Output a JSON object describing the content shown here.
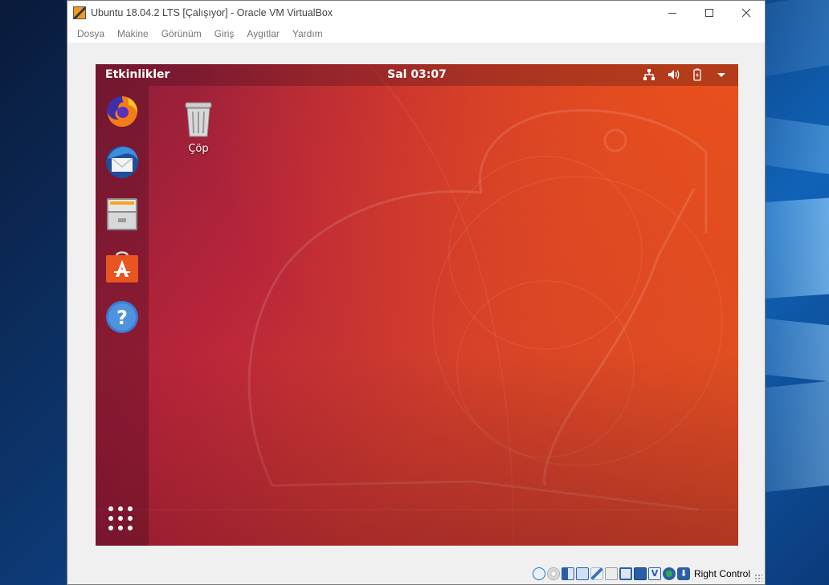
{
  "window": {
    "title": "Ubuntu 18.04.2 LTS [Çalışıyor] - Oracle VM VirtualBox",
    "menu": [
      "Dosya",
      "Makine",
      "Görünüm",
      "Giriş",
      "Aygıtlar",
      "Yardım"
    ]
  },
  "guest": {
    "topbar": {
      "activities": "Etkinlikler",
      "clock": "Sal 03:07"
    },
    "dock": {
      "items": [
        {
          "name": "firefox-icon"
        },
        {
          "name": "thunderbird-icon"
        },
        {
          "name": "files-icon"
        },
        {
          "name": "ubuntu-software-icon"
        },
        {
          "name": "help-icon"
        }
      ],
      "show_apps_icon": "apps-grid-icon"
    },
    "desktop": {
      "trash_label": "Çöp"
    },
    "tray_icons": [
      "network-icon",
      "volume-icon",
      "battery-icon",
      "menu-arrow-icon"
    ]
  },
  "statusbar": {
    "host_key": "Right Control"
  },
  "colors": {
    "ubuntu_orange": "#e95420",
    "aubergine": "#77216f"
  }
}
